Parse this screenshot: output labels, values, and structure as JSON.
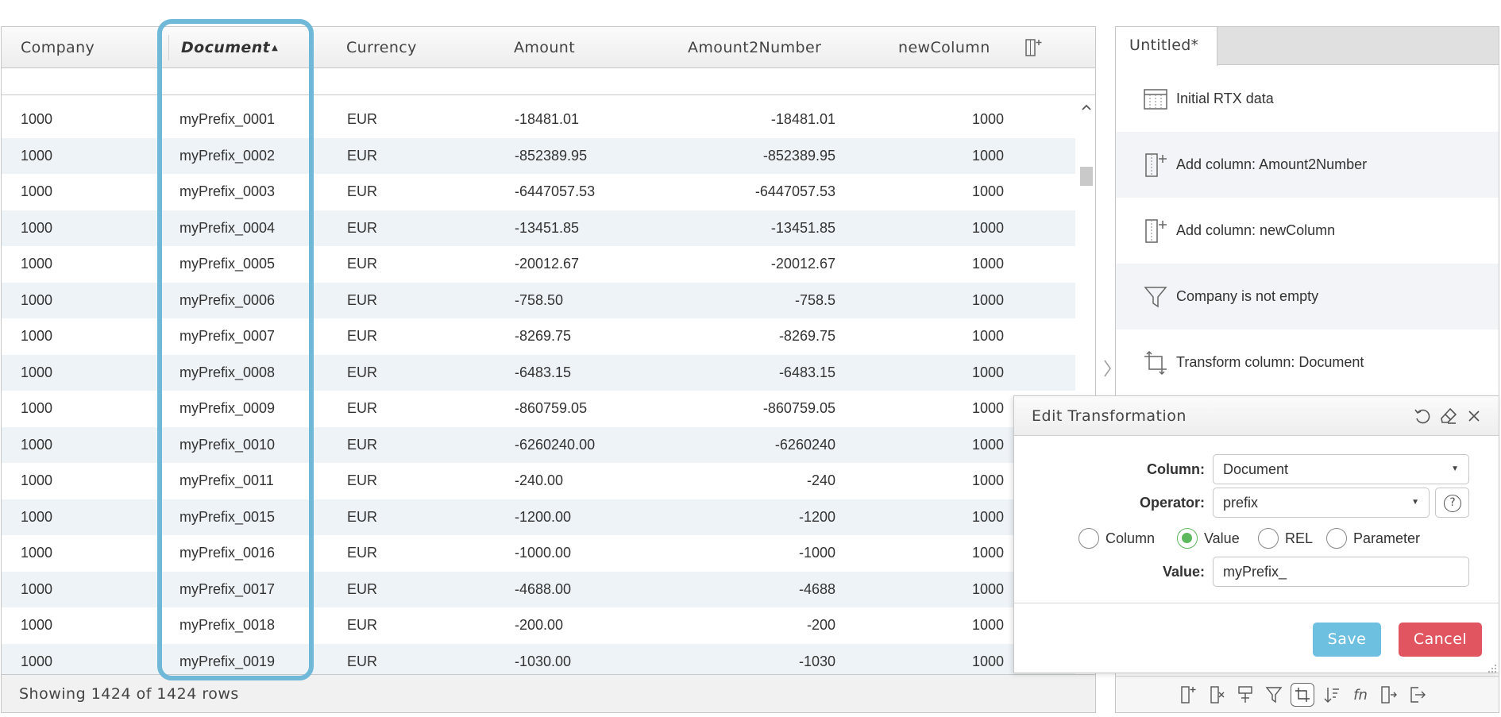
{
  "grid": {
    "columns": [
      "Company",
      "Document",
      "Currency",
      "Amount",
      "Amount2Number",
      "newColumn"
    ],
    "sorted_column": "Document",
    "rows": [
      [
        "1000",
        "myPrefix_0001",
        "EUR",
        "-18481.01",
        "-18481.01",
        "1000"
      ],
      [
        "1000",
        "myPrefix_0002",
        "EUR",
        "-852389.95",
        "-852389.95",
        "1000"
      ],
      [
        "1000",
        "myPrefix_0003",
        "EUR",
        "-6447057.53",
        "-6447057.53",
        "1000"
      ],
      [
        "1000",
        "myPrefix_0004",
        "EUR",
        "-13451.85",
        "-13451.85",
        "1000"
      ],
      [
        "1000",
        "myPrefix_0005",
        "EUR",
        "-20012.67",
        "-20012.67",
        "1000"
      ],
      [
        "1000",
        "myPrefix_0006",
        "EUR",
        "-758.50",
        "-758.5",
        "1000"
      ],
      [
        "1000",
        "myPrefix_0007",
        "EUR",
        "-8269.75",
        "-8269.75",
        "1000"
      ],
      [
        "1000",
        "myPrefix_0008",
        "EUR",
        "-6483.15",
        "-6483.15",
        "1000"
      ],
      [
        "1000",
        "myPrefix_0009",
        "EUR",
        "-860759.05",
        "-860759.05",
        "1000"
      ],
      [
        "1000",
        "myPrefix_0010",
        "EUR",
        "-6260240.00",
        "-6260240",
        "1000"
      ],
      [
        "1000",
        "myPrefix_0011",
        "EUR",
        "-240.00",
        "-240",
        "1000"
      ],
      [
        "1000",
        "myPrefix_0015",
        "EUR",
        "-1200.00",
        "-1200",
        "1000"
      ],
      [
        "1000",
        "myPrefix_0016",
        "EUR",
        "-1000.00",
        "-1000",
        "1000"
      ],
      [
        "1000",
        "myPrefix_0017",
        "EUR",
        "-4688.00",
        "-4688",
        "1000"
      ],
      [
        "1000",
        "myPrefix_0018",
        "EUR",
        "-200.00",
        "-200",
        "1000"
      ],
      [
        "1000",
        "myPrefix_0019",
        "EUR",
        "-1030.00",
        "-1030",
        "1000"
      ]
    ],
    "footer": "Showing 1424 of 1424 rows"
  },
  "panel": {
    "tab": "Untitled*",
    "steps": [
      {
        "label": "Initial RTX data",
        "icon": "table-icon"
      },
      {
        "label": "Add column: Amount2Number",
        "icon": "add-column-icon"
      },
      {
        "label": "Add column: newColumn",
        "icon": "add-column-icon"
      },
      {
        "label": "Company is not empty",
        "icon": "filter-icon"
      },
      {
        "label": "Transform column: Document",
        "icon": "transform-icon"
      }
    ],
    "toolbar_fn": "fn"
  },
  "dialog": {
    "title": "Edit Transformation",
    "column_label": "Column:",
    "column_value": "Document",
    "operator_label": "Operator:",
    "operator_value": "prefix",
    "help_glyph": "?",
    "radios": [
      "Column",
      "Value",
      "REL",
      "Parameter"
    ],
    "selected_radio": "Value",
    "value_label": "Value:",
    "value": "myPrefix_",
    "save": "Save",
    "cancel": "Cancel"
  },
  "colors": {
    "highlight": "#6fb8d8",
    "save": "#6ec0e0",
    "cancel": "#e05560",
    "radio_checked": "#5cb85c",
    "row_alt": "#eef3f7"
  }
}
